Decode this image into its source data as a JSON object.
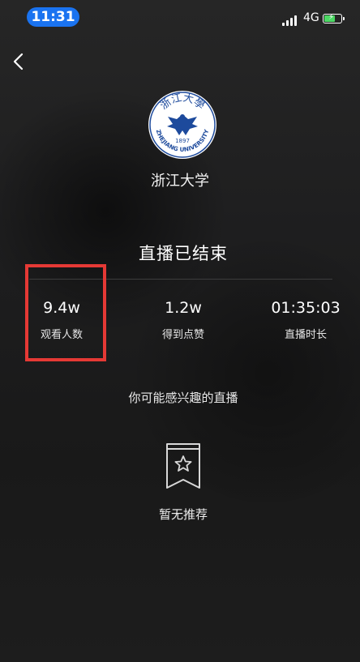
{
  "status_bar": {
    "time": "11:31",
    "network": "4G",
    "battery_level": 0.6,
    "colors": {
      "time_pill": "#1a73f0",
      "battery_fill": "#4cd964"
    }
  },
  "nav": {
    "back_icon": "chevron-left-icon"
  },
  "channel": {
    "name": "浙江大学",
    "logo_text_top": "浙江大學",
    "logo_year": "1897",
    "logo_text_bottom": "ZHEJIANG UNIVERSITY"
  },
  "live": {
    "status_title": "直播已结束"
  },
  "stats": [
    {
      "value": "9.4w",
      "label": "观看人数"
    },
    {
      "value": "1.2w",
      "label": "得到点赞"
    },
    {
      "value": "01:35:03",
      "label": "直播时长"
    }
  ],
  "annotation": {
    "highlight_color": "#e53935"
  },
  "recommend": {
    "title": "你可能感兴趣的直播",
    "empty_icon": "bookmark-star-icon",
    "empty_text": "暂无推荐"
  }
}
